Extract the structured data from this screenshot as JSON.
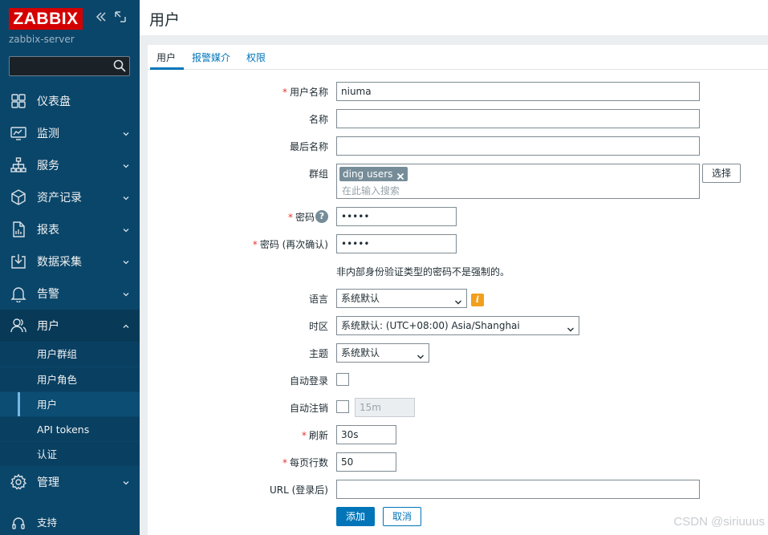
{
  "app": {
    "logo_text": "ZABBIX",
    "server_name": "zabbix-server",
    "page_title": "用户",
    "colors": {
      "sidebar": "#0a466a",
      "accent": "#0275b8",
      "logo": "#d40000",
      "required": "#e33734",
      "warning": "#f19f1d"
    }
  },
  "sidebar": {
    "items": [
      {
        "label": "仪表盘",
        "icon": "dashboard-icon"
      },
      {
        "label": "监测",
        "icon": "monitoring-icon"
      },
      {
        "label": "服务",
        "icon": "services-icon"
      },
      {
        "label": "资产记录",
        "icon": "inventory-icon"
      },
      {
        "label": "报表",
        "icon": "reports-icon"
      },
      {
        "label": "数据采集",
        "icon": "data-collection-icon"
      },
      {
        "label": "告警",
        "icon": "alerts-icon"
      },
      {
        "label": "用户",
        "icon": "users-icon"
      },
      {
        "label": "管理",
        "icon": "administration-icon"
      }
    ],
    "users_submenu": [
      "用户群组",
      "用户角色",
      "用户",
      "API tokens",
      "认证"
    ],
    "support": "支持"
  },
  "tabs": [
    "用户",
    "报警媒介",
    "权限"
  ],
  "form": {
    "username": {
      "label": "用户名称",
      "value": "niuma"
    },
    "name": {
      "label": "名称",
      "value": ""
    },
    "surname": {
      "label": "最后名称",
      "value": ""
    },
    "groups": {
      "label": "群组",
      "chip": "ding users",
      "placeholder": "在此输入搜索",
      "select_button": "选择"
    },
    "password": {
      "label": "密码",
      "value": "•••••"
    },
    "password_confirm": {
      "label": "密码 (再次确认)",
      "value": "•••••"
    },
    "password_note": "非内部身份验证类型的密码不是强制的。",
    "language": {
      "label": "语言",
      "value": "系统默认"
    },
    "timezone": {
      "label": "时区",
      "value": "系统默认: (UTC+08:00) Asia/Shanghai"
    },
    "theme": {
      "label": "主题",
      "value": "系统默认"
    },
    "autologin": {
      "label": "自动登录"
    },
    "autologout": {
      "label": "自动注销",
      "value": "15m"
    },
    "refresh": {
      "label": "刷新",
      "value": "30s"
    },
    "rows_per_page": {
      "label": "每页行数",
      "value": "50"
    },
    "url": {
      "label": "URL (登录后)",
      "value": ""
    },
    "add_button": "添加",
    "cancel_button": "取消"
  },
  "watermark": "CSDN @siriuuus"
}
